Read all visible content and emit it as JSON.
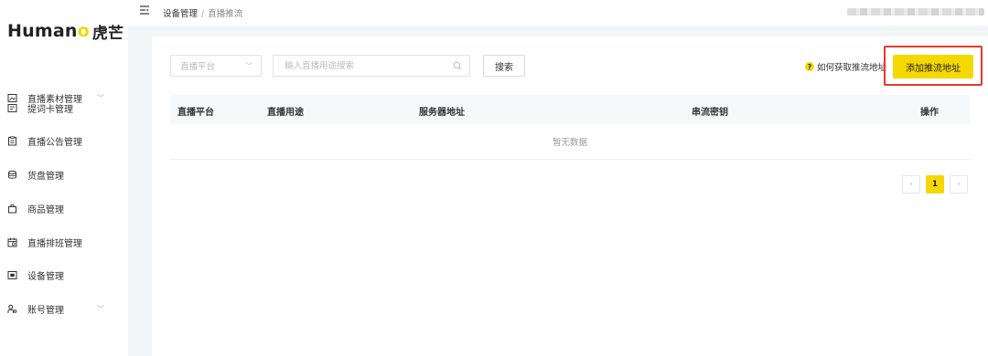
{
  "brand": {
    "logo_text_pre": "Human",
    "logo_text_accent": "o",
    "logo_text_cn": "虎芒"
  },
  "sidebar": {
    "items": [
      {
        "label": "直播素材管理",
        "icon": "image-icon",
        "has_chevron": true
      },
      {
        "label": "提词卡管理",
        "icon": "card-icon",
        "has_chevron": false
      },
      {
        "label": "直播公告管理",
        "icon": "notice-icon",
        "has_chevron": false
      },
      {
        "label": "货盘管理",
        "icon": "box-icon",
        "has_chevron": false
      },
      {
        "label": "商品管理",
        "icon": "bag-icon",
        "has_chevron": false
      },
      {
        "label": "直播排班管理",
        "icon": "calendar-icon",
        "has_chevron": false
      },
      {
        "label": "设备管理",
        "icon": "device-icon",
        "has_chevron": false
      },
      {
        "label": "账号管理",
        "icon": "account-icon",
        "has_chevron": true
      }
    ],
    "chevron": "﹀"
  },
  "breadcrumb": {
    "parent": "设备管理",
    "separator": "/",
    "current": "直播推流"
  },
  "filters": {
    "platform_placeholder": "直播平台",
    "search_placeholder": "输入直播用途搜索",
    "search_button": "搜索"
  },
  "help_link": {
    "icon": "?",
    "text": "如何获取推流地址"
  },
  "add_button": "添加推流地址",
  "table": {
    "columns": [
      "直播平台",
      "直播用途",
      "服务器地址",
      "串流密钥",
      "操作"
    ],
    "empty_text": "暂无数据"
  },
  "pagination": {
    "prev": "‹",
    "current": "1",
    "next": "›"
  },
  "colors": {
    "accent": "#f5d800",
    "highlight_border": "#e03a2f"
  }
}
